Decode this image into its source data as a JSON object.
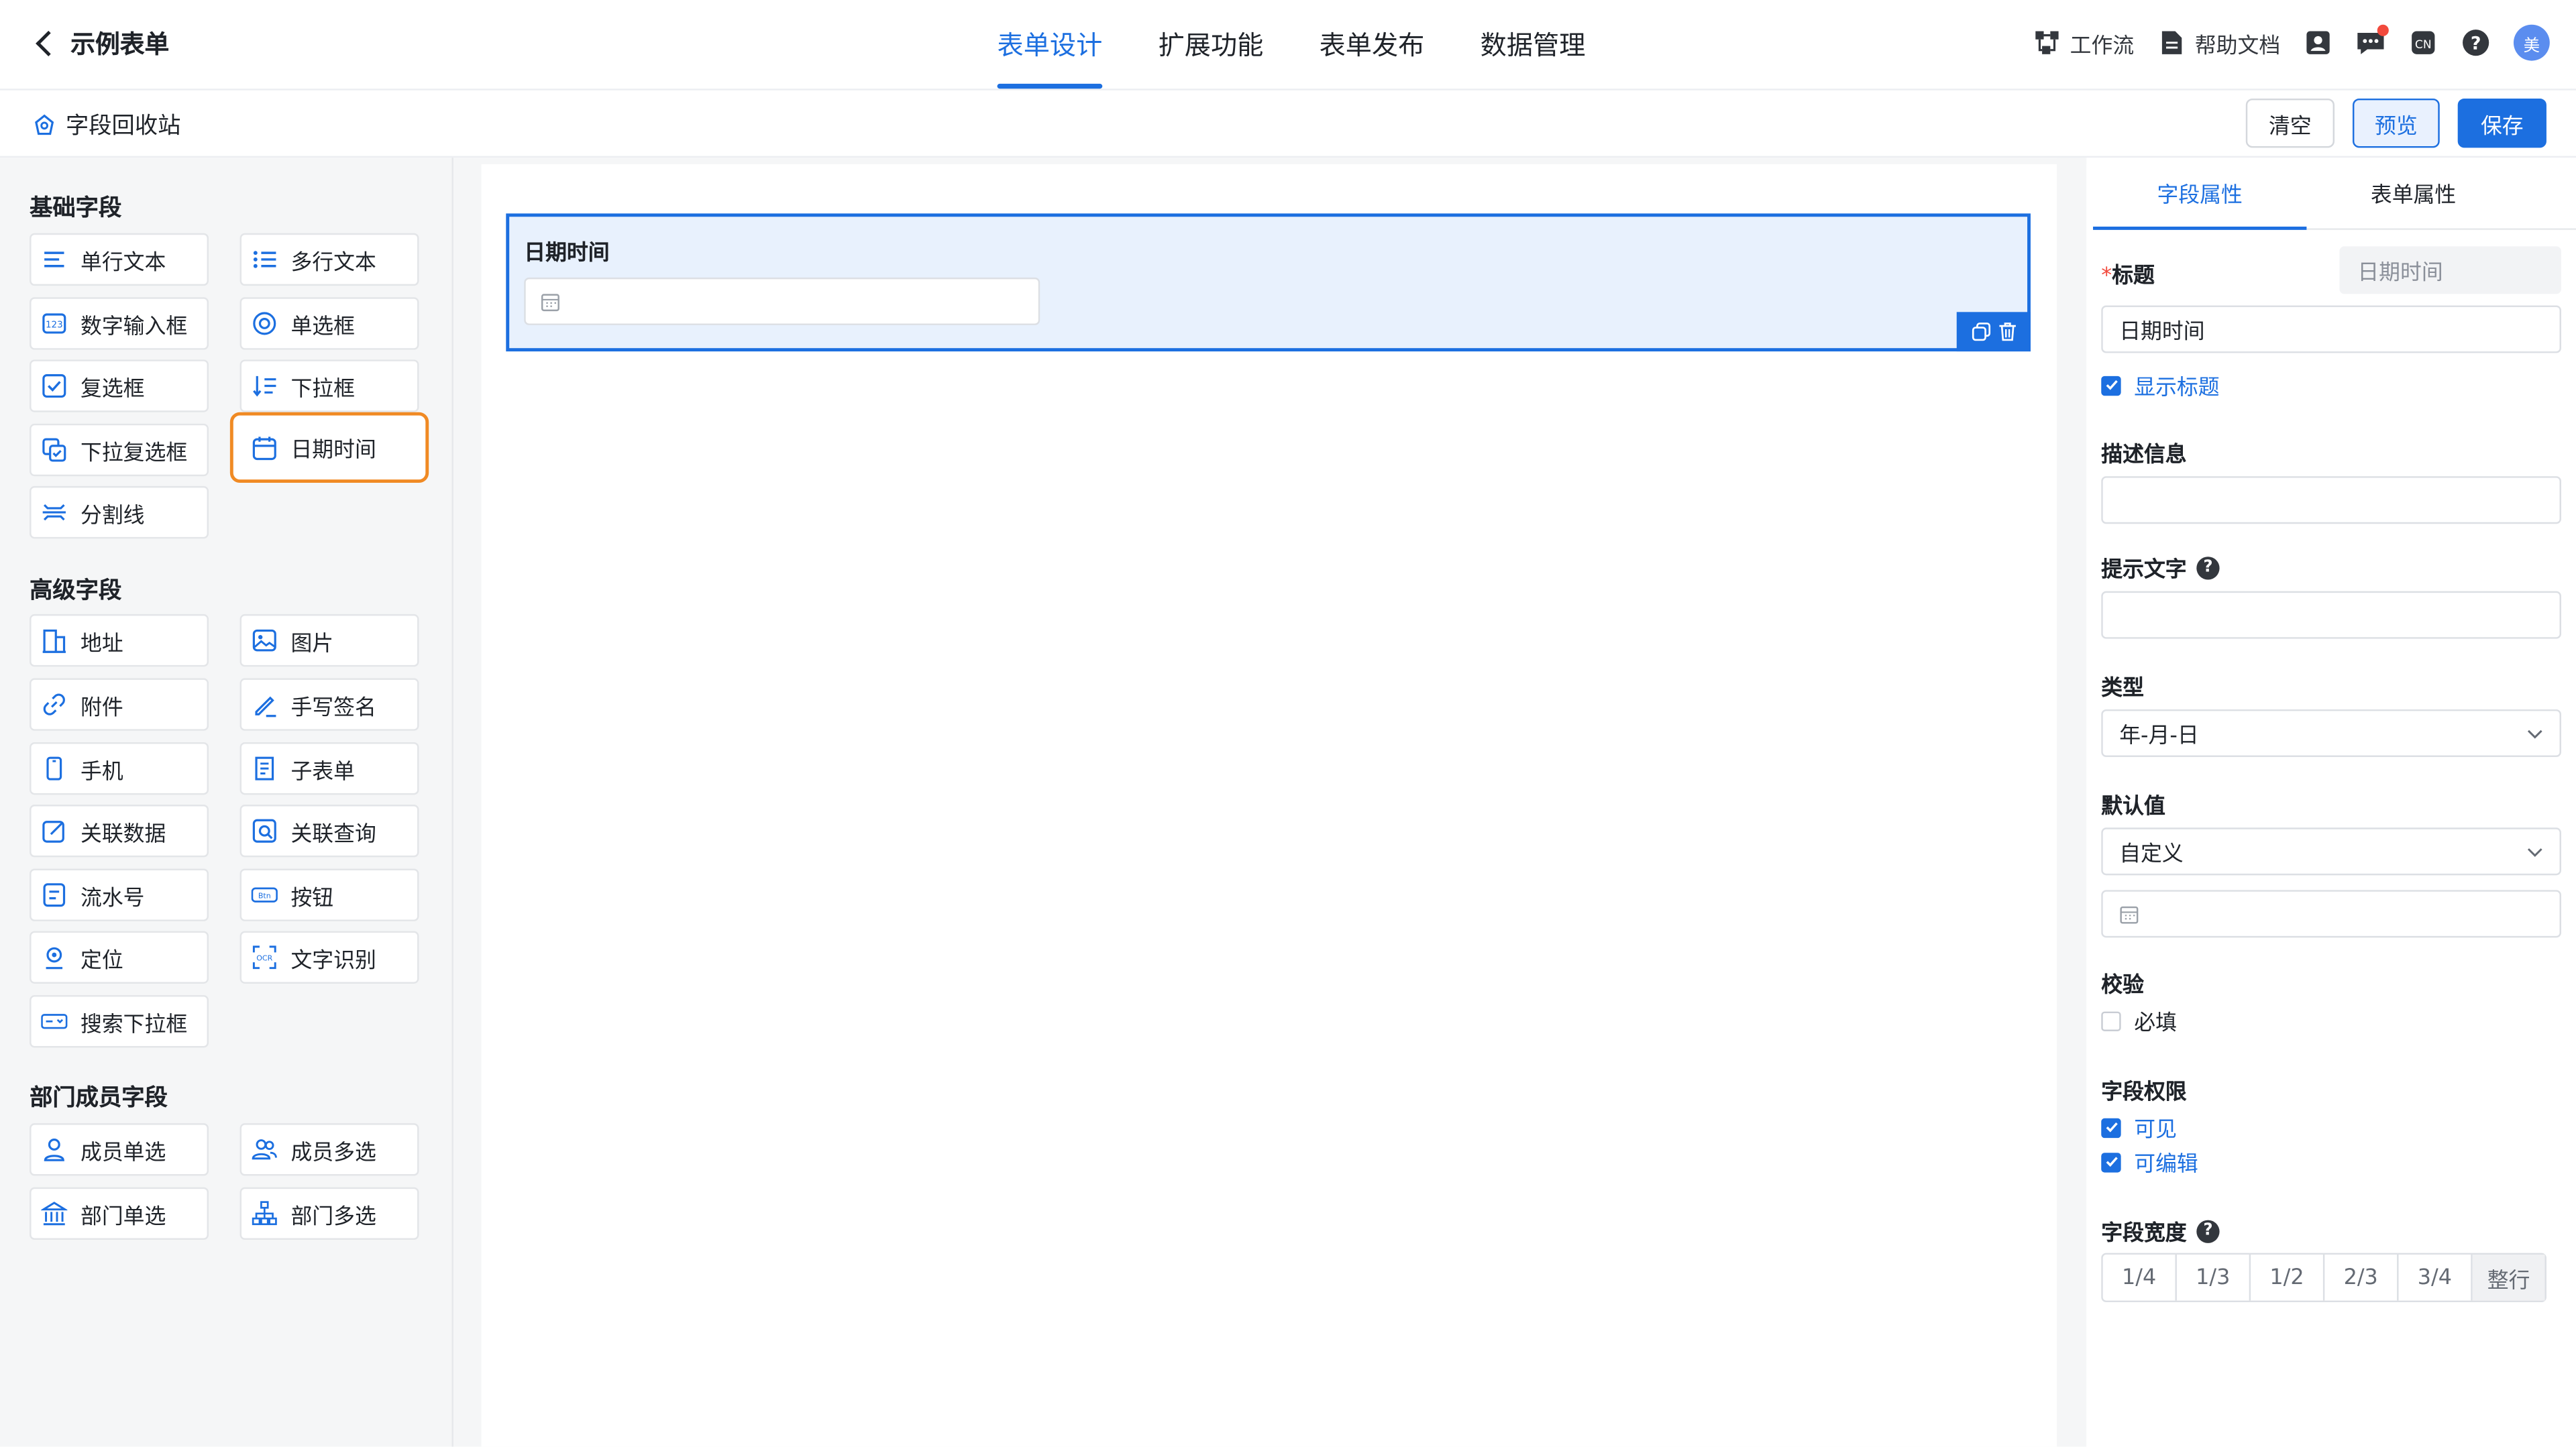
{
  "app": {
    "back_title": "示例表单"
  },
  "nav": {
    "tabs": [
      "表单设计",
      "扩展功能",
      "表单发布",
      "数据管理"
    ],
    "active_index": 0,
    "tools": {
      "workflow": "工作流",
      "help_docs": "帮助文档",
      "avatar_text": "美"
    }
  },
  "subbar": {
    "recycle": "字段回收站",
    "clear": "清空",
    "preview": "预览",
    "save": "保存"
  },
  "fields": {
    "basic_title": "基础字段",
    "basic": [
      "单行文本",
      "多行文本",
      "数字输入框",
      "单选框",
      "复选框",
      "下拉框",
      "下拉复选框",
      "日期时间",
      "分割线"
    ],
    "advanced_title": "高级字段",
    "advanced": [
      "地址",
      "图片",
      "附件",
      "手写签名",
      "手机",
      "子表单",
      "关联数据",
      "关联查询",
      "流水号",
      "按钮",
      "定位",
      "文字识别",
      "搜索下拉框"
    ],
    "dept_title": "部门成员字段",
    "dept": [
      "成员单选",
      "成员多选",
      "部门单选",
      "部门多选"
    ],
    "selected": "日期时间"
  },
  "canvas": {
    "field_title": "日期时间"
  },
  "props": {
    "tab_field": "字段属性",
    "tab_form": "表单属性",
    "title_label": "标题",
    "title_placeholder": "日期时间",
    "title_value": "日期时间",
    "show_title": "显示标题",
    "desc_label": "描述信息",
    "hint_label": "提示文字",
    "type_label": "类型",
    "type_value": "年-月-日",
    "default_label": "默认值",
    "default_value": "自定义",
    "validate_label": "校验",
    "required": "必填",
    "perm_label": "字段权限",
    "visible": "可见",
    "editable": "可编辑",
    "width_label": "字段宽度",
    "width_options": [
      "1/4",
      "1/3",
      "1/2",
      "2/3",
      "3/4",
      "整行"
    ],
    "width_selected": "整行"
  },
  "colors": {
    "accent": "#1c6fe0",
    "highlight": "#f08a24",
    "danger": "#f24a3d"
  }
}
